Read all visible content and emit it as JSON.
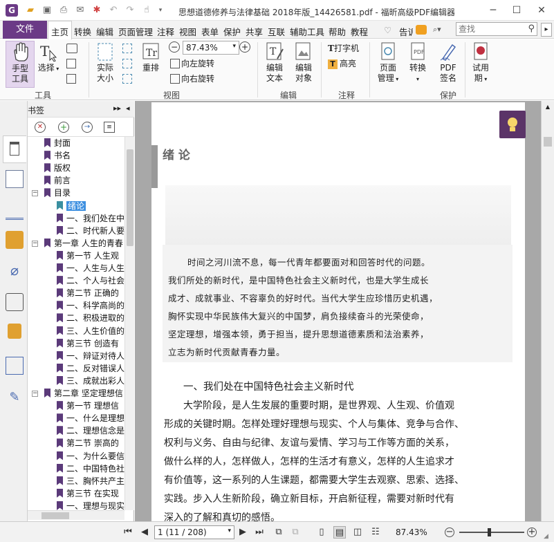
{
  "window": {
    "title": "思想道德修养与法律基础 2018年版_14426581.pdf - 福昕高级PDF编辑器",
    "minimize": "─",
    "maximize": "☐",
    "close": "✕"
  },
  "menu": {
    "file": "文件",
    "tabs": [
      "主页",
      "转换",
      "编辑",
      "页面管理",
      "注释",
      "视图",
      "表单",
      "保护",
      "共享",
      "互联",
      "辅助工具",
      "帮助",
      "教程"
    ],
    "tell_me": "告诉",
    "search_placeholder": "查找"
  },
  "ribbon": {
    "hand_tool": "手型\n工具",
    "select": "选择",
    "actual_size": "实际\n大小",
    "reflow": "重排",
    "zoom_value": "87.43%",
    "rotate_left": "向左旋转",
    "rotate_right": "向右旋转",
    "edit_text": "编辑\n文本",
    "edit_object": "编辑\n对象",
    "typewriter": "打字机",
    "highlight": "高亮",
    "page_management": "页面\n管理",
    "convert": "转换",
    "pdf_sign": "PDF\n签名",
    "trial": "试用\n期",
    "groups": {
      "tools": "工具",
      "view": "视图",
      "edit": "编辑",
      "comment": "注释",
      "protect": "保护"
    }
  },
  "bookmarks": {
    "header": "书签",
    "items": [
      {
        "label": "封面",
        "level": 1
      },
      {
        "label": "书名",
        "level": 1
      },
      {
        "label": "版权",
        "level": 1
      },
      {
        "label": "前言",
        "level": 1
      },
      {
        "label": "目录",
        "level": 1,
        "expanded": true
      },
      {
        "label": "绪论",
        "level": 2,
        "selected": true
      },
      {
        "label": "一、我们处在中",
        "level": 2
      },
      {
        "label": "二、时代新人要",
        "level": 2
      },
      {
        "label": "第一章  人生的青春",
        "level": 1,
        "expanded": true
      },
      {
        "label": "第一节  人生观",
        "level": 2
      },
      {
        "label": "一、人生与人生",
        "level": 2
      },
      {
        "label": "二、个人与社会",
        "level": 2
      },
      {
        "label": "第二节  正确的",
        "level": 2
      },
      {
        "label": "一、科学高尚的",
        "level": 2
      },
      {
        "label": "二、积极进取的",
        "level": 2
      },
      {
        "label": "三、人生价值的",
        "level": 2
      },
      {
        "label": "第三节  创造有",
        "level": 2
      },
      {
        "label": "一、辩证对待人",
        "level": 2
      },
      {
        "label": "二、反对错误人",
        "level": 2
      },
      {
        "label": "三、成就出彩人",
        "level": 2
      },
      {
        "label": "第二章  坚定理想信",
        "level": 1,
        "expanded": true
      },
      {
        "label": "第一节  理想信",
        "level": 2
      },
      {
        "label": "一、什么是理想",
        "level": 2
      },
      {
        "label": "二、理想信念是",
        "level": 2
      },
      {
        "label": "第二节  崇高的",
        "level": 2
      },
      {
        "label": "一、为什么要信",
        "level": 2
      },
      {
        "label": "二、中国特色社",
        "level": 2
      },
      {
        "label": "三、胸怀共产主",
        "level": 2
      },
      {
        "label": "第三节  在实现",
        "level": 2
      },
      {
        "label": "一、理想与现实",
        "level": 2
      }
    ]
  },
  "document": {
    "chapter_title": "绪  论",
    "quote_lines": [
      "时间之河川流不息，每一代青年都要面对和回答时代的问题。",
      "我们所处的新时代，是中国特色社会主义新时代，也是大学生成长",
      "成才、成就事业、不容辜负的好时代。当代大学生应珍惜历史机遇，",
      "胸怀实现中华民族伟大复兴的中国梦，肩负接续奋斗的光荣使命，",
      "坚定理想，增强本领，勇于担当，提升思想道德素质和法治素养，",
      "立志为新时代贡献青春力量。"
    ],
    "section_title": "一、我们处在中国特色社会主义新时代",
    "body_lines": [
      "大学阶段，是人生发展的重要时期，是世界观、人生观、价值观",
      "形成的关键时期。怎样处理好理想与现实、个人与集体、竞争与合作、",
      "权利与义务、自由与纪律、友谊与爱情、学习与工作等方面的关系，",
      "做什么样的人，怎样做人，怎样的生活才有意义，怎样的人生追求才",
      "有价值等，这一系列的人生课题，都需要大学生去观察、思索、选择、",
      "实践。步入人生新阶段，确立新目标，开启新征程，需要对新时代有",
      "深入的了解和真切的感悟。"
    ]
  },
  "status": {
    "page_indicator": "1 (11 / 208)",
    "zoom": "87.43%"
  },
  "colors": {
    "accent_purple": "#6b3a86",
    "bookmark_flag": "#5b3a7a",
    "selection_blue": "#3d8fe0",
    "canvas_gray": "#a8a8a8"
  }
}
